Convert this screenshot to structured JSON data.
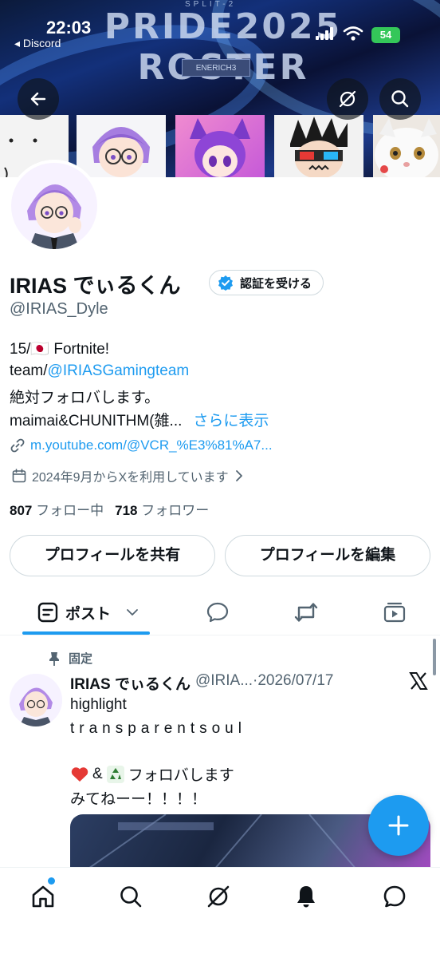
{
  "status_bar": {
    "time": "22:03",
    "back_app": "◂ Discord",
    "battery": "54"
  },
  "banner": {
    "title": "PRIDE2025 ROSTER",
    "subtitle": "SPLIT-2",
    "tag": "ENERICH3"
  },
  "profile": {
    "display_name": "IRIAS でぃるくん",
    "verify_label": "認証を受ける",
    "handle": "@IRIAS_Dyle",
    "bio": {
      "line1_prefix": "15/",
      "line1_flag": "🇯🇵",
      "line1_suffix": " Fortnite!",
      "line2_prefix": "team/",
      "line2_link": "@IRIASGamingteam",
      "line3": "絶対フォロバします。",
      "line4": "maimai&CHUNITHM(雑...",
      "show_more": "さらに表示"
    },
    "website": "m.youtube.com/@VCR_%E3%81%A7...",
    "joined": "2024年9月からXを利用しています",
    "following_count": "807",
    "following_label": "フォロー中",
    "followers_count": "718",
    "followers_label": "フォロワー"
  },
  "actions": {
    "share_profile": "プロフィールを共有",
    "edit_profile": "プロフィールを編集"
  },
  "tabs": {
    "posts_label": "ポスト"
  },
  "post": {
    "pinned_label": "固定",
    "author": "IRIAS でぃるくん",
    "meta": "@IRIA...·2026/07/17",
    "line1": "highlight",
    "line2": "transparentsoul",
    "line3_text": "フォロバします",
    "line3_amp": "&",
    "line4": "みてねーー！！！！"
  },
  "colors": {
    "accent": "#1d9bf0",
    "text": "#0f1419",
    "secondary": "#536471"
  }
}
